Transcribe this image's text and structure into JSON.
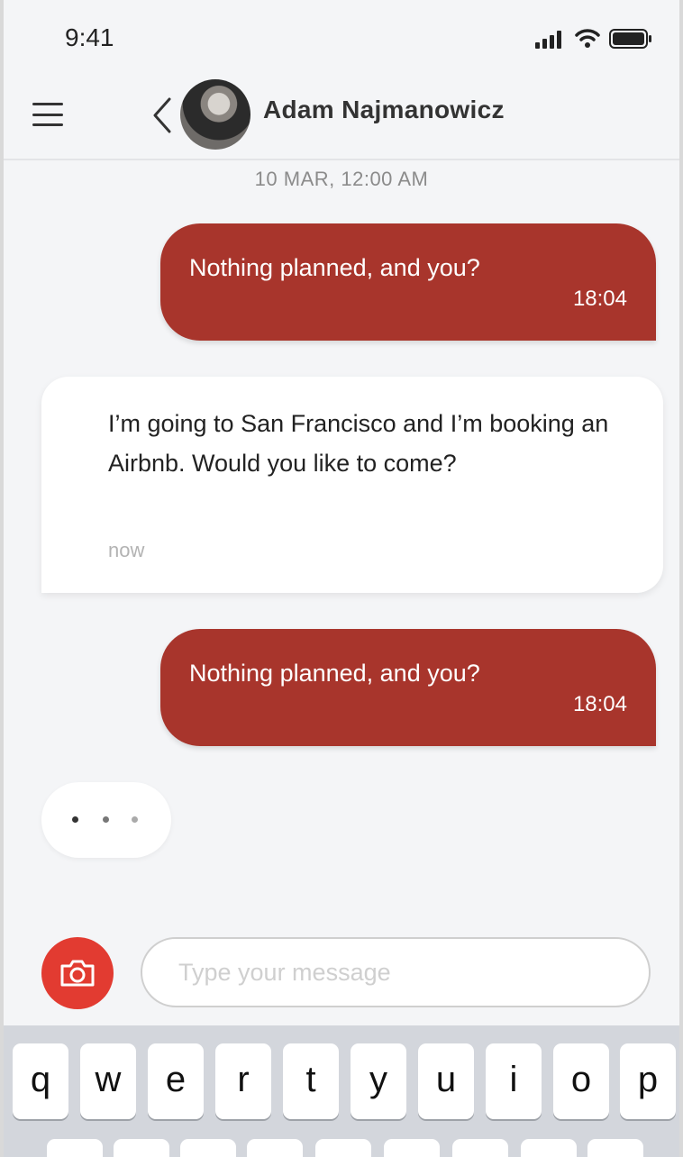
{
  "status_bar": {
    "time": "9:41"
  },
  "header": {
    "contact_name": "Adam Najmanowicz"
  },
  "conversation": {
    "date_separator": "10 MAR, 12:00 AM",
    "messages": [
      {
        "direction": "outgoing",
        "text": "Nothing planned, and you?",
        "time": "18:04"
      },
      {
        "direction": "incoming",
        "text": "I’m going to San Francisco and I’m booking an Airbnb. Would you like to come?",
        "time": "now"
      },
      {
        "direction": "outgoing",
        "text": "Nothing planned, and you?",
        "time": "18:04"
      }
    ],
    "typing_indicator": true
  },
  "composer": {
    "placeholder": "Type your message",
    "value": ""
  },
  "keyboard": {
    "row1": [
      "q",
      "w",
      "e",
      "r",
      "t",
      "y",
      "u",
      "i",
      "o",
      "p"
    ]
  },
  "colors": {
    "outgoing_bubble": "#a8352c",
    "camera_button": "#e23b31",
    "background": "#f4f5f7"
  },
  "icons": [
    "signal-icon",
    "wifi-icon",
    "battery-icon",
    "menu-icon",
    "back-chevron-icon",
    "camera-icon"
  ]
}
